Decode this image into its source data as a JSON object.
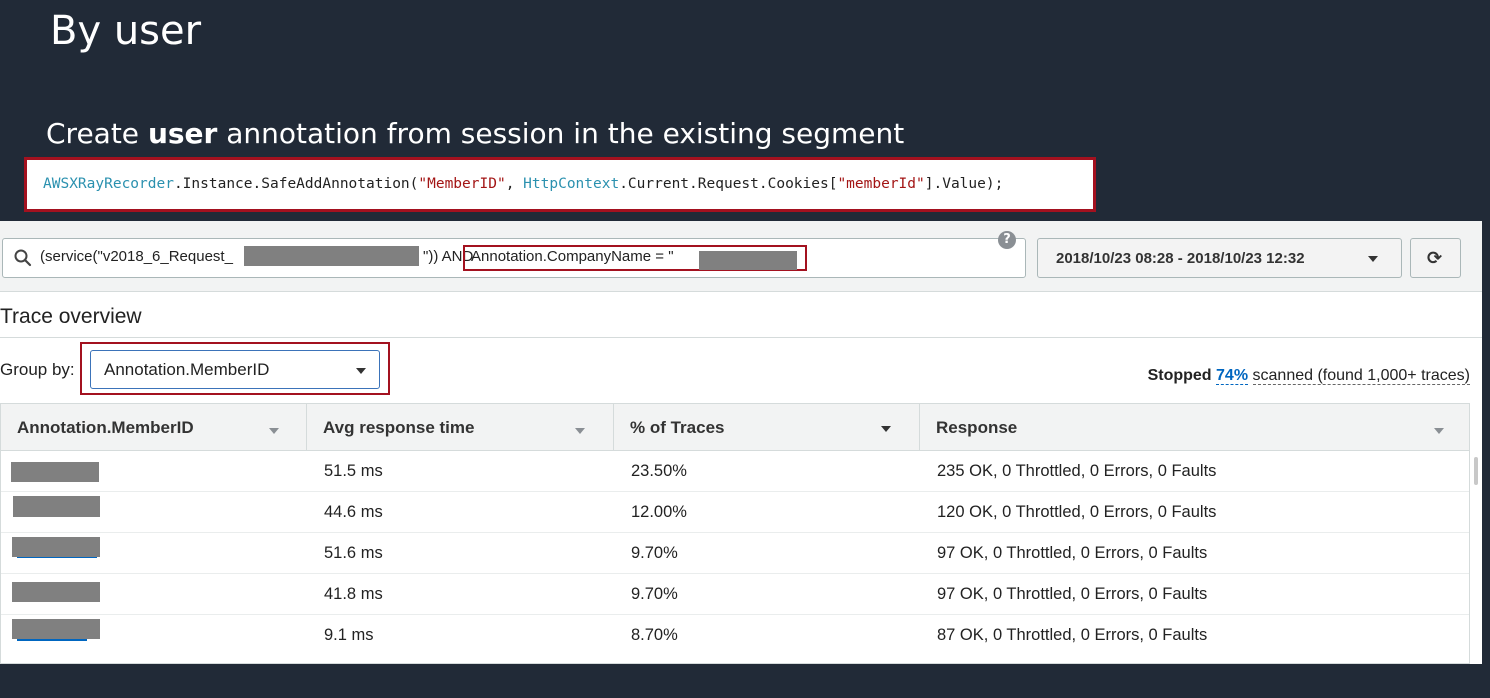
{
  "slide": {
    "title": "By user",
    "subtitle_pre": "Create ",
    "subtitle_bold": "user",
    "subtitle_post": " annotation from session in the existing segment"
  },
  "code": {
    "t1": "AWSXRayRecorder",
    "t2": ".Instance.SafeAddAnnotation(",
    "t3": "\"MemberID\"",
    "t4": ", ",
    "t5": "HttpContext",
    "t6": ".Current.Request.Cookies[",
    "t7": "\"memberId\"",
    "t8": "].Value);"
  },
  "search": {
    "query_part1": "(service(\"v2018_6_Request_",
    "query_part2": "\")) AND",
    "query_part3": "Annotation.CompanyName = \""
  },
  "time_range": {
    "label": "2018/10/23 08:28 - 2018/10/23 12:32"
  },
  "overview": {
    "title": "Trace overview"
  },
  "group_by": {
    "label": "Group by:",
    "selected": "Annotation.MemberID"
  },
  "scan_status": {
    "stopped": "Stopped",
    "percent": "74%",
    "rest": "scanned (found 1,000+ traces)"
  },
  "table": {
    "columns": [
      "Annotation.MemberID",
      "Avg response time",
      "% of Traces",
      "Response"
    ],
    "rows": [
      {
        "member_id": "",
        "avg": "51.5 ms",
        "pct": "23.50%",
        "response": "235 OK, 0 Throttled, 0 Errors, 0 Faults"
      },
      {
        "member_id": "",
        "avg": "44.6 ms",
        "pct": "12.00%",
        "response": "120 OK, 0 Throttled, 0 Errors, 0 Faults"
      },
      {
        "member_id": "",
        "avg": "51.6 ms",
        "pct": "9.70%",
        "response": "97 OK, 0 Throttled, 0 Errors, 0 Faults"
      },
      {
        "member_id": "",
        "avg": "41.8 ms",
        "pct": "9.70%",
        "response": "97 OK, 0 Throttled, 0 Errors, 0 Faults"
      },
      {
        "member_id": "",
        "avg": "9.1 ms",
        "pct": "8.70%",
        "response": "87 OK, 0 Throttled, 0 Errors, 0 Faults"
      }
    ]
  },
  "colors": {
    "slide_bg": "#212a37",
    "highlight_border": "#a3111f",
    "link_blue": "#0066c0"
  }
}
